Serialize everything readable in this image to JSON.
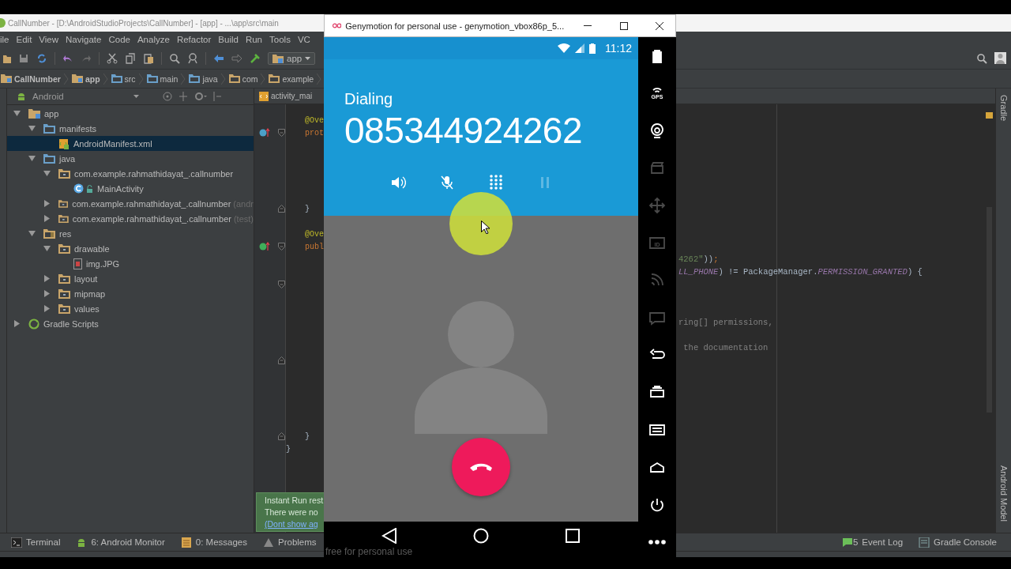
{
  "ide": {
    "title": "CallNumber - [D:\\AndroidStudioProjects\\CallNumber] - [app] - ...\\app\\src\\main",
    "menu": [
      "ile",
      "Edit",
      "View",
      "Navigate",
      "Code",
      "Analyze",
      "Refactor",
      "Build",
      "Run",
      "Tools",
      "VC"
    ],
    "run_config": "app",
    "breadcrumbs": [
      {
        "label": "CallNumber",
        "kind": "module"
      },
      {
        "label": "app",
        "kind": "module"
      },
      {
        "label": "src",
        "kind": "folder"
      },
      {
        "label": "main",
        "kind": "folder"
      },
      {
        "label": "java",
        "kind": "folder"
      },
      {
        "label": "com",
        "kind": "package"
      },
      {
        "label": "example",
        "kind": "package"
      }
    ],
    "project_view": "Android",
    "editor_tab": "activity_mai",
    "tree": [
      {
        "label": "app",
        "kind": "module",
        "expanded": true,
        "selected": false,
        "children": [
          {
            "label": "manifests",
            "kind": "folder",
            "expanded": true,
            "selected": false,
            "children": [
              {
                "label": "AndroidManifest.xml",
                "kind": "manifest",
                "selected": true
              }
            ]
          },
          {
            "label": "java",
            "kind": "folder",
            "expanded": true,
            "selected": false,
            "children": [
              {
                "label": "com.example.rahmathidayat_.callnumber",
                "kind": "package",
                "expanded": true,
                "selected": false,
                "children": [
                  {
                    "label": "MainActivity",
                    "kind": "class",
                    "selected": false
                  }
                ]
              },
              {
                "label": "com.example.rahmathidayat_.callnumber",
                "suffix": "(andr",
                "kind": "package",
                "expanded": false,
                "selected": false
              },
              {
                "label": "com.example.rahmathidayat_.callnumber",
                "suffix": "(test)",
                "kind": "package",
                "expanded": false,
                "selected": false
              }
            ]
          },
          {
            "label": "res",
            "kind": "resfolder",
            "expanded": true,
            "selected": false,
            "children": [
              {
                "label": "drawable",
                "kind": "package",
                "expanded": true,
                "selected": false,
                "children": [
                  {
                    "label": "img.JPG",
                    "kind": "image",
                    "selected": false
                  }
                ]
              },
              {
                "label": "layout",
                "kind": "package",
                "expanded": false,
                "selected": false
              },
              {
                "label": "mipmap",
                "kind": "package",
                "expanded": false,
                "selected": false
              },
              {
                "label": "values",
                "kind": "package",
                "expanded": false,
                "selected": false
              }
            ]
          }
        ]
      },
      {
        "label": "Gradle Scripts",
        "kind": "gradle",
        "expanded": false,
        "selected": false
      }
    ],
    "code_lines": [
      {
        "kind": "code",
        "left": [
          {
            "text": "    @Ove",
            "kind": "annotation"
          }
        ]
      },
      {
        "kind": "code",
        "left": [
          {
            "text": "    prot",
            "kind": "keyword"
          }
        ],
        "overrides": true,
        "fold_start": true
      },
      {
        "kind": "blank"
      },
      {
        "kind": "blank"
      },
      {
        "kind": "blank"
      },
      {
        "kind": "blank"
      },
      {
        "kind": "blank"
      },
      {
        "kind": "code",
        "left": [
          {
            "text": "    }",
            "kind": "plain"
          }
        ],
        "fold_end": true
      },
      {
        "kind": "blank"
      },
      {
        "kind": "code",
        "left": [
          {
            "text": "    @Ove",
            "kind": "annotation"
          }
        ]
      },
      {
        "kind": "code",
        "left": [
          {
            "text": "    publ",
            "kind": "keyword"
          }
        ],
        "implements": true,
        "fold_start": true
      },
      {
        "kind": "code",
        "right": [
          {
            "text": "4262\"",
            "kind": "string"
          },
          {
            "text": "))",
            "kind": "plain"
          },
          {
            "text": ";",
            "kind": "keyword"
          }
        ]
      },
      {
        "kind": "code",
        "right": [
          {
            "text": "LL_PHONE",
            "kind": "constant"
          },
          {
            "text": ") != PackageManager.",
            "kind": "plain"
          },
          {
            "text": "PERMISSION_GRANTED",
            "kind": "constant"
          },
          {
            "text": ") {",
            "kind": "plain"
          }
        ]
      },
      {
        "kind": "blank",
        "fold_start": true
      },
      {
        "kind": "blank"
      },
      {
        "kind": "blank"
      },
      {
        "kind": "code",
        "right": [
          {
            "text": "ring[] permissions,",
            "kind": "comment"
          }
        ]
      },
      {
        "kind": "blank"
      },
      {
        "kind": "code",
        "right": [
          {
            "text": " the documentation",
            "kind": "comment"
          }
        ]
      },
      {
        "kind": "blank",
        "fold_end": true
      },
      {
        "kind": "blank"
      },
      {
        "kind": "blank"
      },
      {
        "kind": "blank"
      },
      {
        "kind": "blank"
      },
      {
        "kind": "blank"
      },
      {
        "kind": "code",
        "left": [
          {
            "text": "    }",
            "kind": "plain"
          }
        ],
        "fold_end": true
      },
      {
        "kind": "code",
        "left": [
          {
            "text": "}",
            "kind": "plain"
          }
        ]
      }
    ],
    "right_tools": [
      "Gradle",
      "Android Model"
    ],
    "notification": {
      "lines": [
        "Instant Run rest",
        "There were no"
      ],
      "link": "(Dont show ag"
    },
    "bottom_left": [
      {
        "label": "Terminal",
        "kind": "terminal"
      },
      {
        "label": "6: Android Monitor",
        "kind": "android"
      },
      {
        "label": "0: Messages",
        "kind": "messages"
      },
      {
        "label": "Problems",
        "kind": "problems"
      }
    ],
    "bottom_right": [
      {
        "label": "Event Log",
        "kind": "event",
        "count": "5"
      },
      {
        "label": "Gradle Console",
        "kind": "console"
      }
    ]
  },
  "emulator": {
    "title": "Genymotion for personal use - genymotion_vbox86p_5...",
    "time": "11:12",
    "call_state": "Dialing",
    "number": "085344924262",
    "call_controls": [
      {
        "kind": "speaker",
        "disabled": false
      },
      {
        "kind": "mute",
        "disabled": false
      },
      {
        "kind": "dialpad",
        "disabled": false
      },
      {
        "kind": "hold",
        "disabled": true
      }
    ],
    "sidebar": [
      {
        "kind": "battery",
        "disabled": false
      },
      {
        "kind": "gps",
        "label": "GPS",
        "disabled": false
      },
      {
        "kind": "camera",
        "disabled": false
      },
      {
        "kind": "video",
        "disabled": true
      },
      {
        "kind": "dpad",
        "disabled": true
      },
      {
        "kind": "id",
        "label": "ID",
        "disabled": true
      },
      {
        "kind": "rss",
        "disabled": true
      },
      {
        "kind": "sms",
        "disabled": true
      },
      {
        "kind": "back",
        "disabled": false
      },
      {
        "kind": "recents",
        "disabled": false
      },
      {
        "kind": "menu",
        "disabled": false
      },
      {
        "kind": "home",
        "disabled": false
      },
      {
        "kind": "power",
        "disabled": false
      },
      {
        "kind": "more",
        "disabled": false
      }
    ],
    "nav": [
      {
        "kind": "back"
      },
      {
        "kind": "home"
      },
      {
        "kind": "recents"
      }
    ],
    "footer_note": "free for personal use"
  }
}
